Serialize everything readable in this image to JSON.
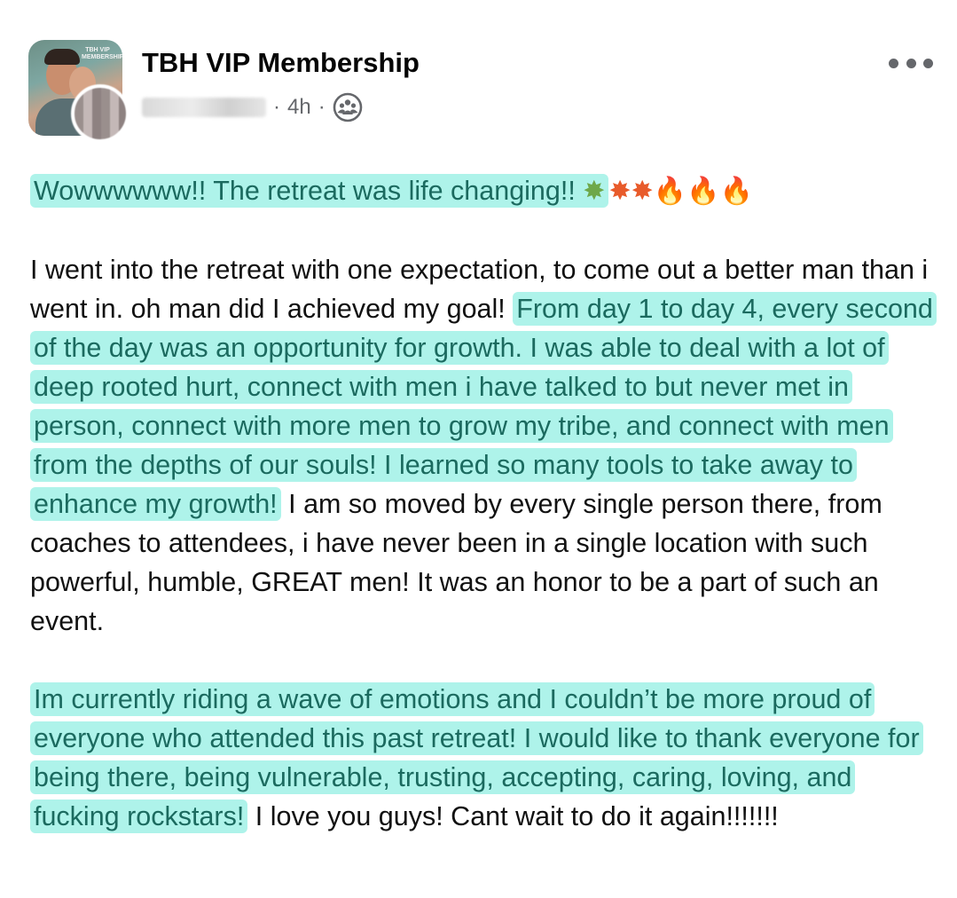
{
  "header": {
    "group_name": "TBH VIP Membership",
    "time_ago": "4h",
    "separator": "·",
    "avatar_logo_text": "TBH VIP MEMBERSHIP",
    "icons": {
      "privacy": "group-audience-icon",
      "menu": "more-options-icon"
    }
  },
  "post": {
    "headline_text": "Wowwwwww!! The retreat was life changing!!",
    "headline_emojis": [
      "✸",
      "✸",
      "✸",
      "🔥",
      "🔥",
      "🔥"
    ],
    "p1_plain_a": "I went into the retreat with one expectation, to come out a better man than i went in. oh man did I achieved my goal! ",
    "p1_highlight": "From day 1 to day 4, every second of the day was an opportunity for growth.  I was able to deal with a lot of deep rooted hurt, connect with men i have talked to but never met in person, connect with more men to grow my tribe, and connect with men from the depths of our souls! I learned so many tools to take away to enhance my growth!",
    "p1_plain_b": " I am so moved by every single person there, from coaches to attendees, i have never been in a single location with such powerful, humble, GREAT men!  It was an honor to be a part of such an event.",
    "p2_highlight": "Im currently riding a wave of emotions and I couldn’t be more proud of everyone who attended this past retreat!  I would like to thank everyone for being there, being vulnerable, trusting, accepting, caring, loving, and fucking rockstars!",
    "p2_plain": " I love you guys! Cant wait to do it again!!!!!!!"
  },
  "colors": {
    "highlight_bg": "#aef3ea",
    "highlight_text": "#1b6a5f",
    "meta_gray": "#65676b"
  }
}
